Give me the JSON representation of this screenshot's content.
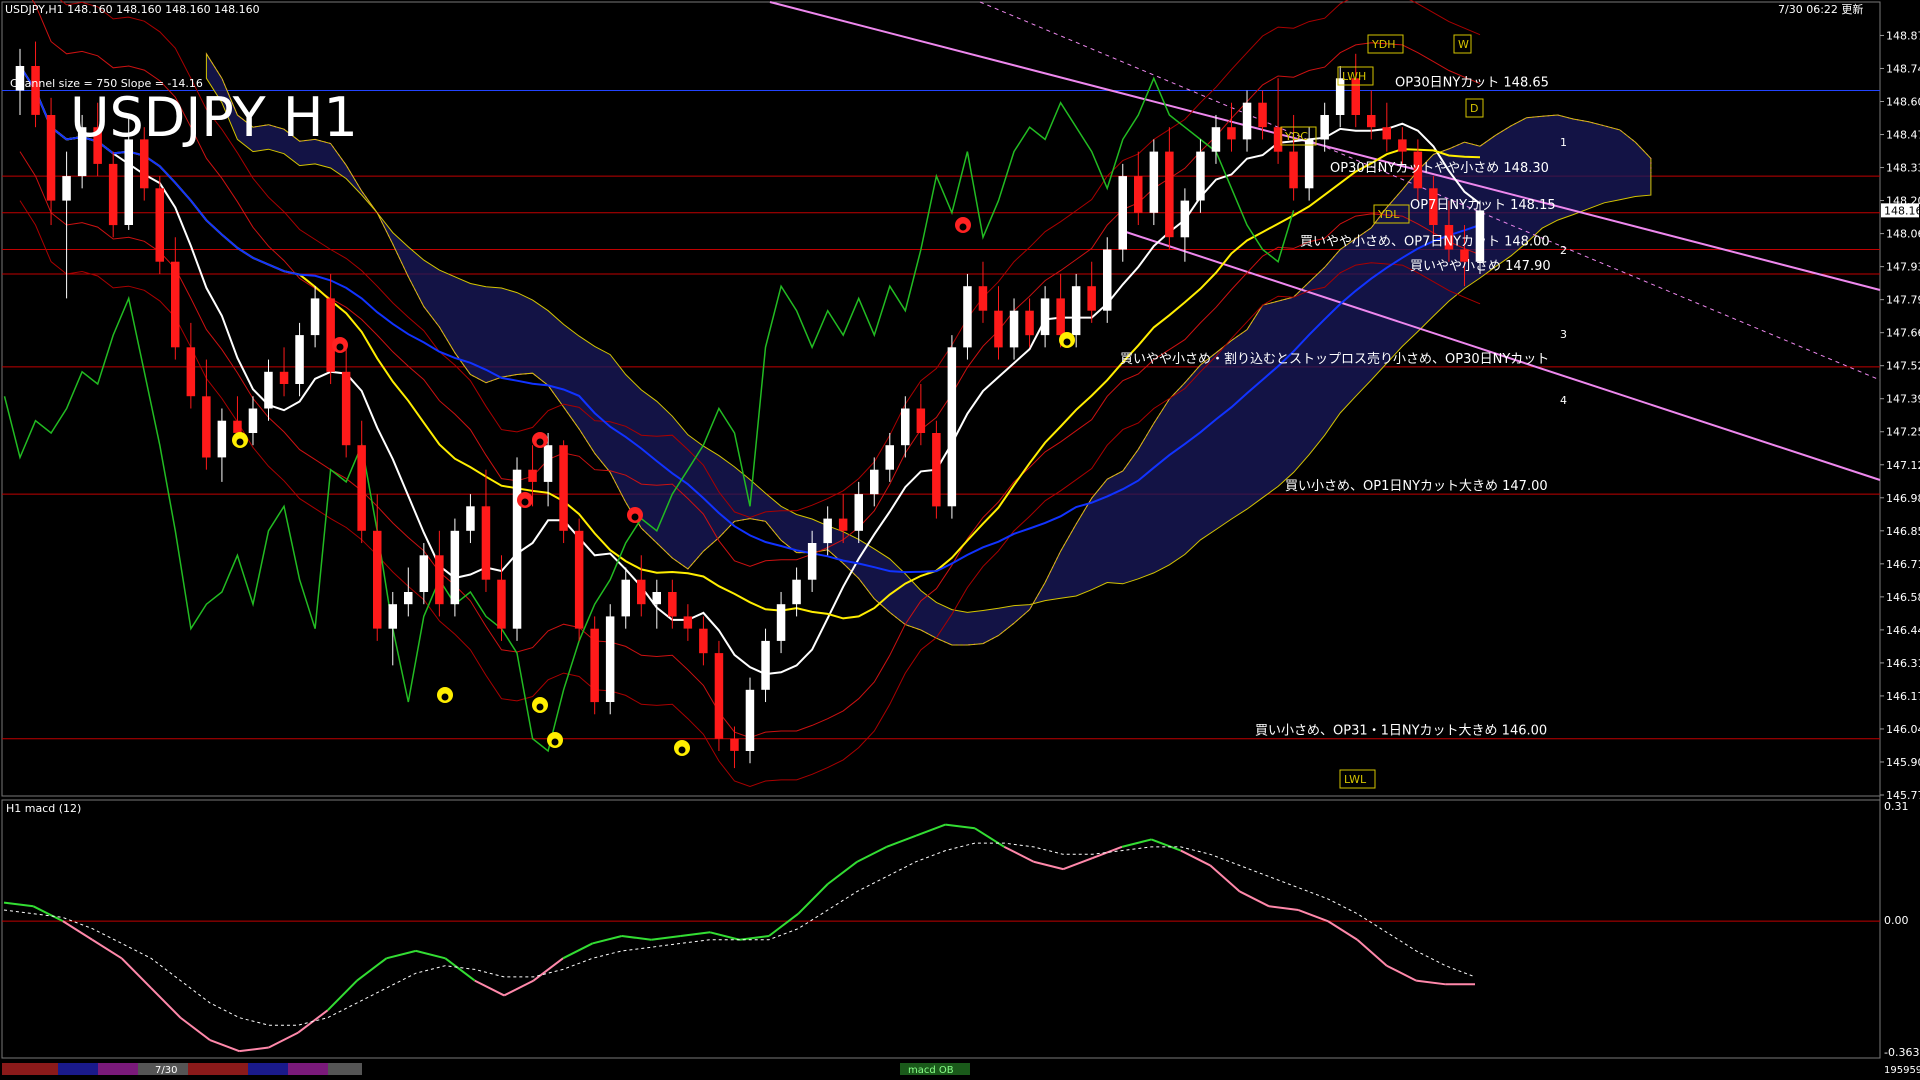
{
  "header": {
    "info": "USDJPY,H1  148.160 148.160 148.160 148.160",
    "updated": "7/30 06:22 更新",
    "channel_info": "Channel size = 750 Slope = -14.16",
    "big_title": "USDJPY H1"
  },
  "indicator": {
    "title": "H1  macd (12)",
    "top_label": "0.31",
    "zero_label": "0.00",
    "bottom_label": "-0.363"
  },
  "bottom_bar": {
    "date_tab": "7/30",
    "macd_tab": "macd OB",
    "volume": "195959"
  },
  "chart_data": {
    "type": "candlestick",
    "symbol": "USDJPY",
    "timeframe": "H1",
    "current_price": "148.160",
    "y_ticks": [
      "148.875",
      "148.740",
      "148.605",
      "148.470",
      "148.335",
      "148.200",
      "148.065",
      "147.930",
      "147.795",
      "147.660",
      "147.525",
      "147.390",
      "147.255",
      "147.120",
      "146.985",
      "146.850",
      "146.715",
      "146.580",
      "146.445",
      "146.310",
      "146.175",
      "146.040",
      "145.905",
      "145.770"
    ],
    "ylim": [
      145.77,
      148.93
    ],
    "levels": [
      {
        "price": 148.65,
        "label": "OP30日NYカット 148.65"
      },
      {
        "price": 148.3,
        "label": "OP30日NYカットやや小さめ 148.30"
      },
      {
        "price": 148.15,
        "label": "OP7日NYカット 148.15"
      },
      {
        "price": 148.0,
        "label": "買いやや小さめ、OP7日NYカット 148.00"
      },
      {
        "price": 147.9,
        "label": "買いやや小さめ 147.90"
      },
      {
        "price": 147.52,
        "label": "買いやや小さめ・割り込むとストップロス売り小さめ、OP30日NYカット"
      },
      {
        "price": 147.0,
        "label": "買い小さめ、OP1日NYカット大きめ 147.00"
      },
      {
        "price": 146.0,
        "label": "買い小さめ、OP31・1日NYカット大きめ 146.00"
      }
    ],
    "markers": [
      "YDH",
      "W",
      "LWH",
      "D",
      "YDC",
      "YDL",
      "LWL",
      "1",
      "2",
      "3",
      "4"
    ],
    "candles": [
      [
        148.65,
        148.82,
        148.55,
        148.75
      ],
      [
        148.75,
        148.85,
        148.5,
        148.55
      ],
      [
        148.55,
        148.62,
        148.1,
        148.2
      ],
      [
        148.2,
        148.4,
        147.8,
        148.3
      ],
      [
        148.3,
        148.55,
        148.25,
        148.5
      ],
      [
        148.5,
        148.6,
        148.3,
        148.35
      ],
      [
        148.35,
        148.4,
        148.05,
        148.1
      ],
      [
        148.1,
        148.55,
        148.08,
        148.45
      ],
      [
        148.45,
        148.5,
        148.2,
        148.25
      ],
      [
        148.25,
        148.3,
        147.9,
        147.95
      ],
      [
        147.95,
        148.05,
        147.55,
        147.6
      ],
      [
        147.6,
        147.7,
        147.35,
        147.4
      ],
      [
        147.4,
        147.55,
        147.1,
        147.15
      ],
      [
        147.15,
        147.35,
        147.05,
        147.3
      ],
      [
        147.3,
        147.4,
        147.2,
        147.25
      ],
      [
        147.25,
        147.4,
        147.2,
        147.35
      ],
      [
        147.35,
        147.55,
        147.3,
        147.5
      ],
      [
        147.5,
        147.6,
        147.4,
        147.45
      ],
      [
        147.45,
        147.7,
        147.4,
        147.65
      ],
      [
        147.65,
        147.85,
        147.6,
        147.8
      ],
      [
        147.8,
        147.9,
        147.45,
        147.5
      ],
      [
        147.5,
        147.6,
        147.15,
        147.2
      ],
      [
        147.2,
        147.3,
        146.8,
        146.85
      ],
      [
        146.85,
        147.0,
        146.4,
        146.45
      ],
      [
        146.45,
        146.6,
        146.3,
        146.55
      ],
      [
        146.55,
        146.7,
        146.5,
        146.6
      ],
      [
        146.6,
        146.8,
        146.55,
        146.75
      ],
      [
        146.75,
        146.85,
        146.5,
        146.55
      ],
      [
        146.55,
        146.9,
        146.5,
        146.85
      ],
      [
        146.85,
        147.0,
        146.8,
        146.95
      ],
      [
        146.95,
        147.1,
        146.6,
        146.65
      ],
      [
        146.65,
        146.75,
        146.4,
        146.45
      ],
      [
        146.45,
        147.15,
        146.4,
        147.1
      ],
      [
        147.1,
        147.2,
        146.95,
        147.05
      ],
      [
        147.05,
        147.25,
        146.95,
        147.2
      ],
      [
        147.2,
        147.22,
        146.8,
        146.85
      ],
      [
        146.85,
        146.9,
        146.4,
        146.45
      ],
      [
        146.45,
        146.5,
        146.1,
        146.15
      ],
      [
        146.15,
        146.55,
        146.1,
        146.5
      ],
      [
        146.5,
        146.7,
        146.45,
        146.65
      ],
      [
        146.65,
        146.75,
        146.5,
        146.55
      ],
      [
        146.55,
        146.65,
        146.45,
        146.6
      ],
      [
        146.6,
        146.65,
        146.45,
        146.5
      ],
      [
        146.5,
        146.55,
        146.4,
        146.45
      ],
      [
        146.45,
        146.5,
        146.3,
        146.35
      ],
      [
        146.35,
        146.4,
        145.95,
        146.0
      ],
      [
        146.0,
        146.05,
        145.88,
        145.95
      ],
      [
        145.95,
        146.25,
        145.9,
        146.2
      ],
      [
        146.2,
        146.45,
        146.15,
        146.4
      ],
      [
        146.4,
        146.6,
        146.35,
        146.55
      ],
      [
        146.55,
        146.7,
        146.5,
        146.65
      ],
      [
        146.65,
        146.85,
        146.6,
        146.8
      ],
      [
        146.8,
        146.95,
        146.75,
        146.9
      ],
      [
        146.9,
        147.0,
        146.8,
        146.85
      ],
      [
        146.85,
        147.05,
        146.8,
        147.0
      ],
      [
        147.0,
        147.15,
        146.95,
        147.1
      ],
      [
        147.1,
        147.25,
        147.05,
        147.2
      ],
      [
        147.2,
        147.4,
        147.15,
        147.35
      ],
      [
        147.35,
        147.45,
        147.2,
        147.25
      ],
      [
        147.25,
        147.3,
        146.9,
        146.95
      ],
      [
        146.95,
        147.65,
        146.9,
        147.6
      ],
      [
        147.6,
        147.9,
        147.55,
        147.85
      ],
      [
        147.85,
        147.95,
        147.7,
        147.75
      ],
      [
        147.75,
        147.85,
        147.55,
        147.6
      ],
      [
        147.6,
        147.8,
        147.55,
        147.75
      ],
      [
        147.75,
        147.8,
        147.6,
        147.65
      ],
      [
        147.65,
        147.85,
        147.6,
        147.8
      ],
      [
        147.8,
        147.9,
        147.6,
        147.65
      ],
      [
        147.65,
        147.9,
        147.6,
        147.85
      ],
      [
        147.85,
        147.95,
        147.7,
        147.75
      ],
      [
        147.75,
        148.05,
        147.7,
        148.0
      ],
      [
        148.0,
        148.35,
        147.95,
        148.3
      ],
      [
        148.3,
        148.4,
        148.1,
        148.15
      ],
      [
        148.15,
        148.45,
        148.1,
        148.4
      ],
      [
        148.4,
        148.5,
        148.0,
        148.05
      ],
      [
        148.05,
        148.25,
        147.95,
        148.2
      ],
      [
        148.2,
        148.45,
        148.15,
        148.4
      ],
      [
        148.4,
        148.55,
        148.35,
        148.5
      ],
      [
        148.5,
        148.6,
        148.4,
        148.45
      ],
      [
        148.45,
        148.65,
        148.4,
        148.6
      ],
      [
        148.6,
        148.65,
        148.45,
        148.5
      ],
      [
        148.5,
        148.7,
        148.35,
        148.4
      ],
      [
        148.4,
        148.55,
        148.2,
        148.25
      ],
      [
        148.25,
        148.5,
        148.2,
        148.45
      ],
      [
        148.45,
        148.6,
        148.4,
        148.55
      ],
      [
        148.55,
        148.75,
        148.5,
        148.7
      ],
      [
        148.7,
        148.8,
        148.5,
        148.55
      ],
      [
        148.55,
        148.65,
        148.45,
        148.5
      ],
      [
        148.5,
        148.6,
        148.4,
        148.45
      ],
      [
        148.45,
        148.5,
        148.35,
        148.4
      ],
      [
        148.4,
        148.45,
        148.2,
        148.25
      ],
      [
        148.25,
        148.3,
        148.05,
        148.1
      ],
      [
        148.1,
        148.2,
        147.95,
        148.0
      ],
      [
        148.0,
        148.1,
        147.85,
        147.95
      ],
      [
        147.95,
        148.2,
        147.9,
        148.16
      ]
    ],
    "macd_series": [
      {
        "values": [
          0.05,
          0.04,
          0.0,
          -0.05,
          -0.1,
          -0.18,
          -0.26,
          -0.32,
          -0.35,
          -0.34,
          -0.3,
          -0.24,
          -0.16,
          -0.1,
          -0.08,
          -0.1,
          -0.16,
          -0.2,
          -0.16,
          -0.1,
          -0.06,
          -0.04,
          -0.05,
          -0.04,
          -0.03,
          -0.05,
          -0.04,
          0.02,
          0.1,
          0.16,
          0.2,
          0.23,
          0.26,
          0.25,
          0.2,
          0.16,
          0.14,
          0.17,
          0.2,
          0.22,
          0.19,
          0.15,
          0.08,
          0.04,
          0.03,
          0.0,
          -0.05,
          -0.12,
          -0.16,
          -0.17,
          -0.17
        ]
      },
      {
        "values": [
          0.03,
          0.02,
          0.01,
          -0.02,
          -0.06,
          -0.1,
          -0.16,
          -0.22,
          -0.26,
          -0.28,
          -0.28,
          -0.26,
          -0.22,
          -0.18,
          -0.14,
          -0.12,
          -0.13,
          -0.15,
          -0.15,
          -0.13,
          -0.1,
          -0.08,
          -0.07,
          -0.06,
          -0.05,
          -0.05,
          -0.05,
          -0.02,
          0.03,
          0.08,
          0.12,
          0.16,
          0.19,
          0.21,
          0.21,
          0.2,
          0.18,
          0.18,
          0.19,
          0.2,
          0.2,
          0.18,
          0.15,
          0.12,
          0.09,
          0.06,
          0.02,
          -0.03,
          -0.08,
          -0.12,
          -0.15
        ]
      }
    ]
  }
}
